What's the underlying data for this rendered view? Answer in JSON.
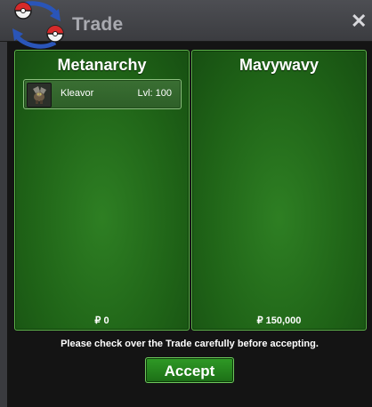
{
  "window": {
    "title": "Trade",
    "close_symbol": "✕",
    "logo_icon": "pokeball-swap-icon"
  },
  "left_panel": {
    "player_name": "Metanarchy",
    "money": "₽ 0",
    "items": [
      {
        "name": "Kleavor",
        "level": "Lvl: 100",
        "icon": "kleavor-sprite-icon"
      }
    ]
  },
  "right_panel": {
    "player_name": "Mavywavy",
    "money": "₽ 150,000",
    "items": []
  },
  "notice": "Please check over the Trade carefully before accepting.",
  "accept_label": "Accept",
  "colors": {
    "panel_green": "#1f6317",
    "panel_border": "#5db44a",
    "accept_green": "#2f9a26",
    "title_text": "#a9aab0"
  }
}
